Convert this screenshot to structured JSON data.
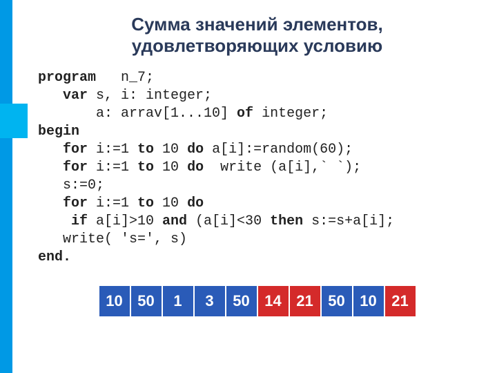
{
  "title_line1": "Сумма значений элементов,",
  "title_line2": "удовлетворяющих условию",
  "code": {
    "l1a": "program",
    "l1b": "   n_7;",
    "l2a": "   var ",
    "l2b": "s, i: integer;",
    "l3a": "       a: arrav[1...10] ",
    "l3b": "of",
    "l3c": " integer;",
    "l4": "begin",
    "l5a": "   for ",
    "l5b": "i:=1 ",
    "l5c": "to",
    "l5d": " 10 ",
    "l5e": "do",
    "l5f": " a[i]:=random(60);",
    "l6a": "   for ",
    "l6b": "i:=1 ",
    "l6c": "to",
    "l6d": " 10 ",
    "l6e": "do",
    "l6f": "  write (a[i],` `);",
    "l7": "   s:=0;",
    "l8a": "   for ",
    "l8b": "i:=1 ",
    "l8c": "to",
    "l8d": " 10 ",
    "l8e": "do",
    "l9a": "    if ",
    "l9b": "a[i]>10 ",
    "l9c": "and",
    "l9d": " (a[i]<30 ",
    "l9e": "then",
    "l9f": " s:=s+a[i];",
    "l10": "   write( 's=', s)",
    "l11": "end."
  },
  "array": [
    {
      "val": "10",
      "hl": false
    },
    {
      "val": "50",
      "hl": false
    },
    {
      "val": "1",
      "hl": false
    },
    {
      "val": "3",
      "hl": false
    },
    {
      "val": "50",
      "hl": false
    },
    {
      "val": "14",
      "hl": true
    },
    {
      "val": "21",
      "hl": true
    },
    {
      "val": "50",
      "hl": false
    },
    {
      "val": "10",
      "hl": false
    },
    {
      "val": "21",
      "hl": true
    }
  ]
}
